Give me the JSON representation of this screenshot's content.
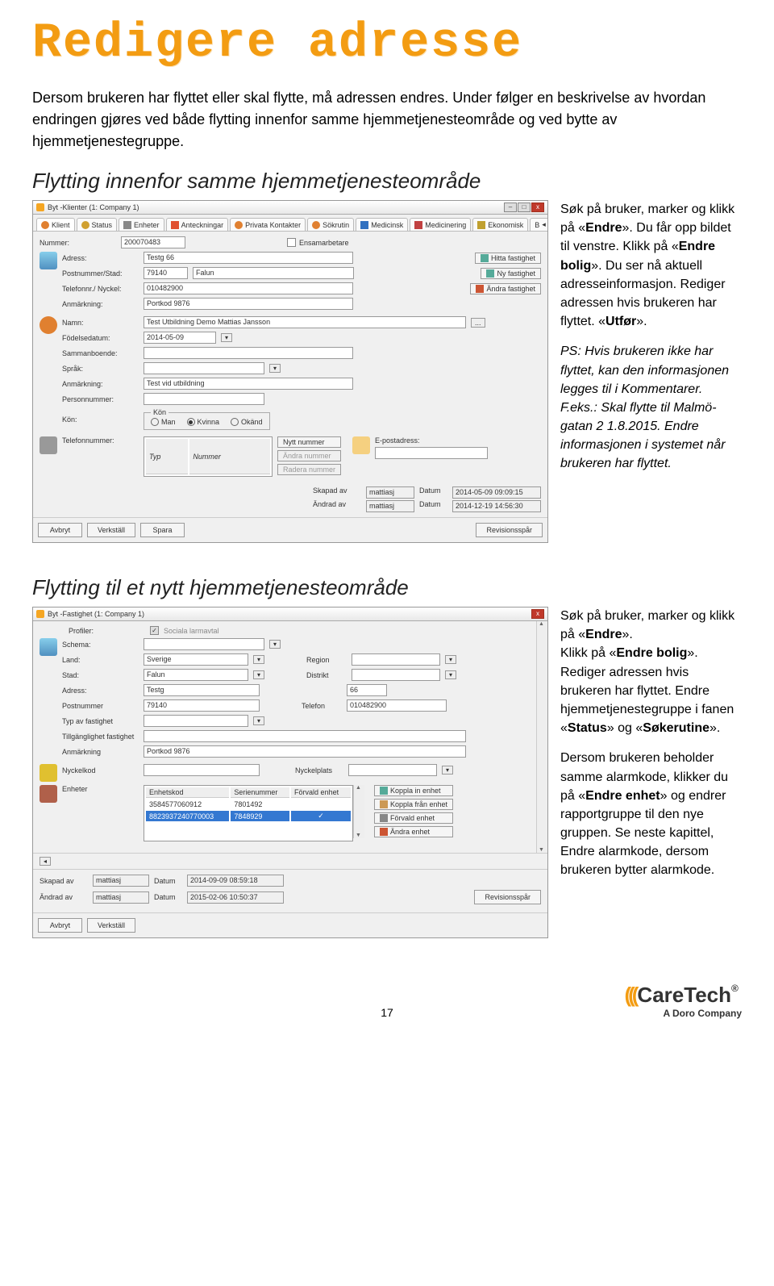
{
  "page": {
    "title": "Redigere adresse",
    "intro": "Dersom brukeren har flyttet eller skal flytte, må adressen endres. Under følger en beskrivelse av hvordan endringen gjøres ved både flytting innenfor samme hjemmetjenesteområde og ved bytte av hjemmetjenestegruppe.",
    "section1_heading": "Flytting innenfor samme hjemmetjenesteområde",
    "section2_heading": "Flytting til et nytt hjemmetjenesteområde",
    "number": "17"
  },
  "side1": {
    "p1_a": "Søk på bruker, marker og klikk på «",
    "p1_b": "Endre",
    "p1_c": "». Du får opp bildet til venstre. Klikk på «",
    "p1_d": "Endre bolig",
    "p1_e": "». Du ser nå aktuell adresseinformasjon. Rediger adressen hvis brukeren har flyttet. «",
    "p1_f": "Utfør",
    "p1_g": "».",
    "p2": "PS: Hvis brukeren ikke har flyttet, kan den informasjonen legges til i Kommentarer. F.eks.: Skal flytte til Malmö­gatan 2 1.8.2015. Endre informasjonen i systemet når brukeren har flyttet."
  },
  "side2": {
    "p1_a": "Søk på bruker, marker og klikk på «",
    "p1_b": "Endre",
    "p1_c": "».",
    "p1_d": "Klikk på «",
    "p1_e": "Endre bolig",
    "p1_f": "». Rediger adressen hvis brukeren har flyttet. Endre hjemmetjenestegruppe i fanen «",
    "p1_g": "Status",
    "p1_h": "» og «",
    "p1_i": "Søkerutine",
    "p1_j": "».",
    "p2_a": "Dersom brukeren beholder samme alarmkode, klikker du på «",
    "p2_b": "Endre enhet",
    "p2_c": "» og endrer rapportgruppe til den nye gruppen. Se neste kapittel, Endre alarmkode, dersom brukeren bytter alarmkode."
  },
  "ss1": {
    "title": "Byt -Klienter (1: Company 1)",
    "tabs": [
      "Klient",
      "Status",
      "Enheter",
      "Anteckningar",
      "Privata Kontakter",
      "Sökrutin",
      "Medicinsk",
      "Medicinering",
      "Ekonomisk",
      "B"
    ],
    "nummer_lbl": "Nummer:",
    "nummer_val": "200070483",
    "ensam_lbl": "Ensamarbetare",
    "adress_lbl": "Adress:",
    "adress_val": "Testg 66",
    "post_lbl": "Postnummer/Stad:",
    "post_val": "79140",
    "stad_val": "Falun",
    "tel_lbl": "Telefonnr./ Nyckel:",
    "tel_val": "010482900",
    "anm_lbl": "Anmärkning:",
    "anm_val": "Portkod 9876",
    "hitta_btn": "Hitta fastighet",
    "ny_btn": "Ny fastighet",
    "andra_btn": "Ändra fastighet",
    "namn_lbl": "Namn:",
    "namn_val": "Test Utbildning Demo Mattias Jansson",
    "fodelse_lbl": "Födelsedatum:",
    "fodelse_val": "2014-05-09",
    "samman_lbl": "Sammanboende:",
    "sprak_lbl": "Språk:",
    "anmark2_lbl": "Anmärkning:",
    "anmark2_val": "Test vid utbildning",
    "person_lbl": "Personnummer:",
    "kon_lbl": "Kön:",
    "kon_legend": "Kön",
    "kon_man": "Man",
    "kon_kvinna": "Kvinna",
    "kon_okant": "Okänd",
    "telefon_lbl": "Telefonnummer:",
    "th_typ": "Typ",
    "th_num": "Nummer",
    "nytt_btn": "Nytt nummer",
    "andra_num_btn": "Ändra nummer",
    "radera_btn": "Radera nummer",
    "epost_lbl": "E-postadress:",
    "skapad_lbl": "Skapad av",
    "skapad_user": "mattiasj",
    "skapad_datum_lbl": "Datum",
    "skapad_datum": "2014-05-09 09:09:15",
    "andrad_lbl": "Ändrad av",
    "andrad_user": "mattiasj",
    "andrad_datum": "2014-12-19 14:56:30",
    "avbryt": "Avbryt",
    "verkstall": "Verkställ",
    "spara": "Spara",
    "revision": "Revisionsspår"
  },
  "ss2": {
    "title": "Byt -Fastighet (1: Company 1)",
    "profiler_lbl": "Profiler:",
    "profiler_val": "Sociala larmavtal",
    "schema_lbl": "Schema:",
    "land_lbl": "Land:",
    "land_val": "Sverige",
    "region_lbl": "Region",
    "stad_lbl": "Stad:",
    "stad_val": "Falun",
    "distrikt_lbl": "Distrikt",
    "adress_lbl": "Adress:",
    "adress_val": "Testg",
    "adress_nr": "66",
    "post_lbl": "Postnummer",
    "post_val": "79140",
    "telefon_lbl": "Telefon",
    "telefon_val": "010482900",
    "typ_lbl": "Typ av fastighet",
    "till_lbl": "Tillgänglighet fastighet",
    "anm_lbl": "Anmärkning",
    "anm_val": "Portkod 9876",
    "nyckel_lbl": "Nyckelkod",
    "nyckelplats_lbl": "Nyckelplats",
    "enheter_lbl": "Enheter",
    "th_enhetskod": "Enhetskod",
    "th_serie": "Serienummer",
    "th_forvald": "Förvald enhet",
    "row1_kod": "3584577060912",
    "row1_serie": "7801492",
    "row2_kod": "8823937240770003",
    "row2_serie": "7848929",
    "koppla_in": "Koppla in enhet",
    "koppla_fran": "Koppla från enhet",
    "forvald": "Förvald enhet",
    "andra_enhet": "Ändra enhet",
    "skapad_lbl": "Skapad av",
    "skapad_user": "mattiasj",
    "skapad_datum_lbl": "Datum",
    "skapad_datum": "2014-09-09 08:59:18",
    "andrad_lbl": "Ändrad av",
    "andrad_user": "mattiasj",
    "andrad_datum": "2015-02-06 10:50:37",
    "revision": "Revisionsspår",
    "avbryt": "Avbryt",
    "verkstall": "Verkställ"
  },
  "brand": {
    "name": "CareTech",
    "sub": "A Doro Company"
  }
}
